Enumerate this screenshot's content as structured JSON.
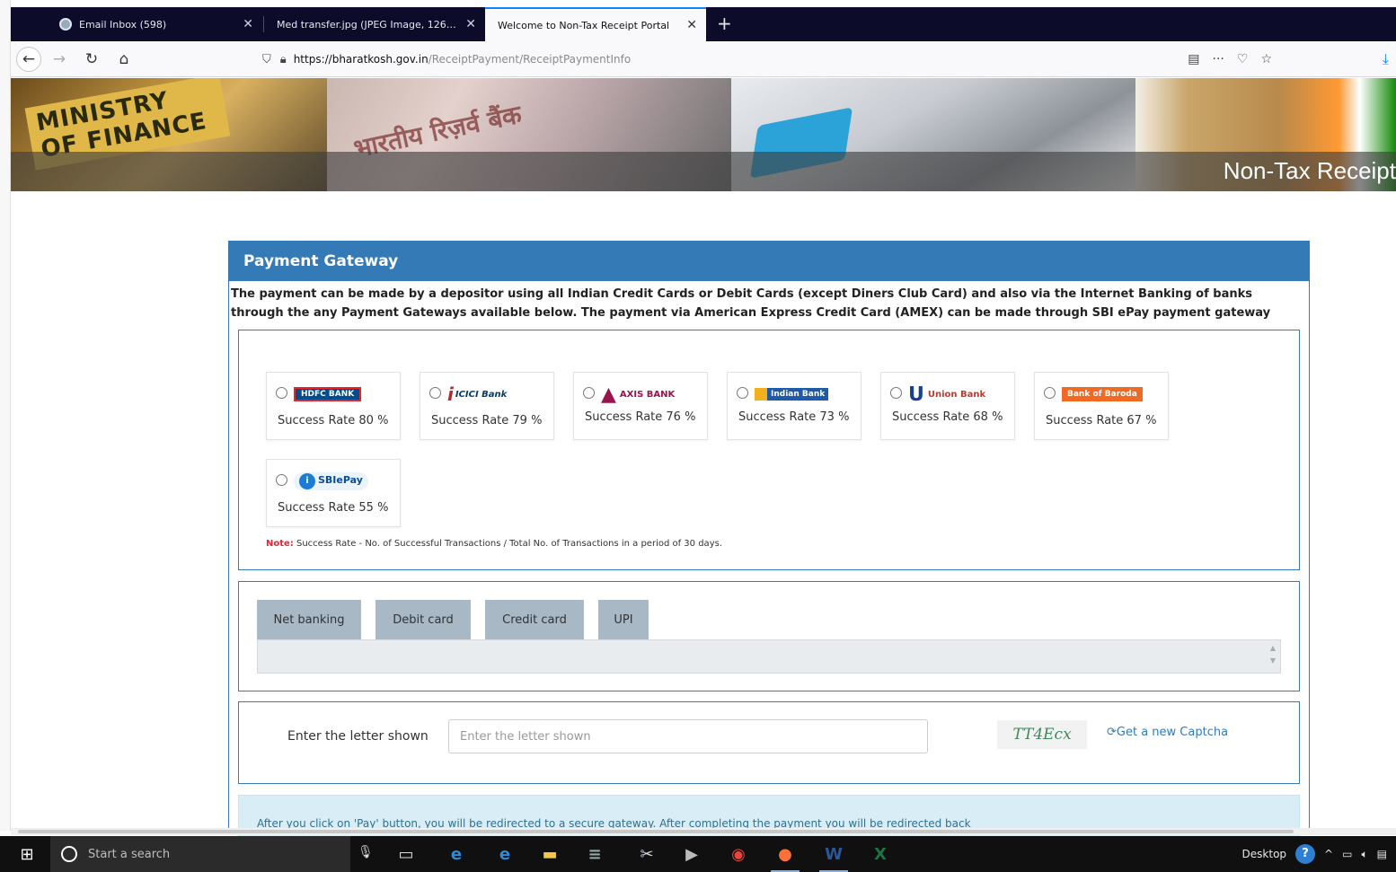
{
  "browser": {
    "tabs": [
      {
        "title": "Email Inbox (598)",
        "active": false
      },
      {
        "title": "Med transfer.jpg (JPEG Image, 126…",
        "active": false
      },
      {
        "title": "Welcome to Non-Tax Receipt Portal",
        "active": true
      }
    ],
    "new_tab": "+",
    "url_host": "https://bharatkosh.gov.in",
    "url_path": "/ReceiptPayment/ReceiptPaymentInfo"
  },
  "banner": {
    "title": "Non-Tax Receipt",
    "ministry_label": "MINISTRY OF FINANCE"
  },
  "panel": {
    "heading": "Payment Gateway",
    "intro": "The payment can be made by a depositor using all Indian Credit Cards or Debit Cards (except Diners Club Card) and also via the Internet Banking of banks through the any Payment Gateways available below. The payment via American Express Credit Card (AMEX) can be made through SBI ePay payment gateway"
  },
  "gateways": [
    {
      "name": "HDFC BANK",
      "rate": "Success Rate 80 %"
    },
    {
      "name": "ICICI Bank",
      "rate": "Success Rate 79 %"
    },
    {
      "name": "AXIS BANK",
      "rate": "Success Rate 76 %"
    },
    {
      "name": "Indian Bank",
      "rate": "Success Rate 73 %"
    },
    {
      "name": "Union Bank",
      "rate": "Success Rate 68 %"
    },
    {
      "name": "Bank of Baroda",
      "rate": "Success Rate 67 %"
    },
    {
      "name": "SBIePay",
      "rate": "Success Rate 55 %"
    }
  ],
  "note": {
    "label": "Note:",
    "text": " Success Rate - No. of Successful Transactions / Total No. of Transactions in a period of 30 days."
  },
  "payment_methods": [
    "Net banking",
    "Debit card",
    "Credit card",
    "UPI"
  ],
  "captcha": {
    "label": "Enter the letter shown",
    "placeholder": "Enter the letter shown",
    "value": "",
    "image_text": "TT4Ecx",
    "refresh_label": "Get a new Captcha"
  },
  "info": {
    "text": "After you click on 'Pay' button, you will be redirected to a secure gateway. After completing the payment you will be redirected back"
  },
  "taskbar": {
    "search_placeholder": "Start a search",
    "tray_label": "Desktop"
  }
}
